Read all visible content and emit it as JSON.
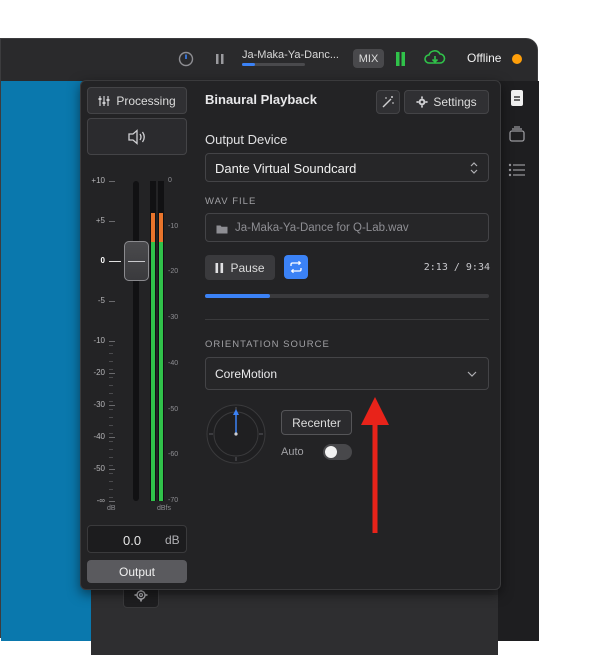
{
  "titlebar": {
    "track_name": "Ja-Maka-Ya-Danc...",
    "track_progress": 0.2,
    "mix_label": "MIX",
    "status": "Offline",
    "status_color": "#ff9f0a",
    "icons": [
      "clock-icon",
      "pause-icon",
      "level-bars-icon",
      "cloud-download-icon"
    ]
  },
  "fader": {
    "processing_label": "Processing",
    "db_value": "0.0",
    "db_unit": "dB",
    "output_label": "Output",
    "scale_left": [
      "+10",
      "+5",
      "0",
      "-5",
      "-10",
      "-20",
      "-30",
      "-40",
      "-50",
      "-∞"
    ],
    "scale_right": [
      "0",
      "-10",
      "-20",
      "-30",
      "-40",
      "-50",
      "-60",
      "-70"
    ],
    "footer_left": "dB",
    "footer_right": "dBfs",
    "fader_level_db": 0,
    "meter_left_level": 0.9,
    "meter_right_level": 0.9
  },
  "panel": {
    "title": "Binaural Playback",
    "settings_label": "Settings",
    "output_device_label": "Output Device",
    "output_device_value": "Dante Virtual Soundcard",
    "wav_file_label": "WAV FILE",
    "wav_file_value": "Ja-Maka-Ya-Dance for Q-Lab.wav",
    "pause_label": "Pause",
    "time_display": "2:13 / 9:34",
    "playback_progress": 0.23,
    "orientation_label": "ORIENTATION SOURCE",
    "orientation_value": "CoreMotion",
    "recenter_label": "Recenter",
    "auto_label": "Auto",
    "auto_enabled": false
  },
  "annotation": {
    "arrow_color": "#e8231a"
  },
  "colors": {
    "accent": "#3b82f6",
    "meter_green": "#30c24a",
    "meter_orange": "#e9742b"
  }
}
